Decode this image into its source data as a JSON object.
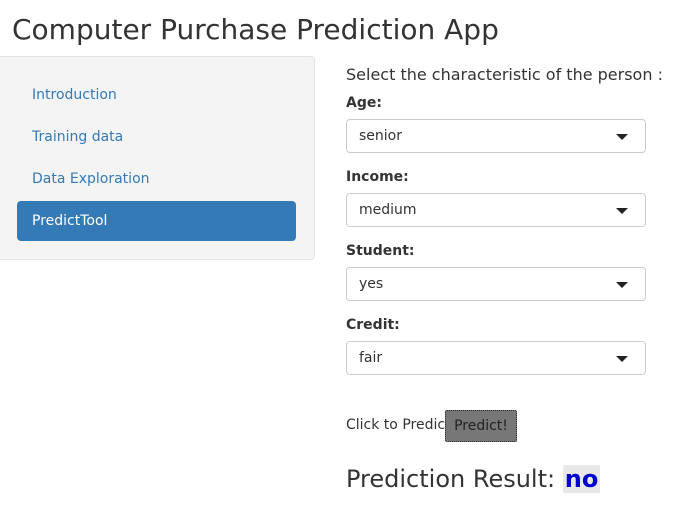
{
  "header": {
    "title": "Computer Purchase Prediction App"
  },
  "sidebar": {
    "items": [
      {
        "label": "Introduction",
        "active": false
      },
      {
        "label": "Training data",
        "active": false
      },
      {
        "label": "Data Exploration",
        "active": false
      },
      {
        "label": "PredictTool",
        "active": true
      }
    ]
  },
  "main": {
    "prompt": "Select the characteristic of the person :",
    "fields": {
      "age": {
        "label": "Age:",
        "value": "senior"
      },
      "income": {
        "label": "Income:",
        "value": "medium"
      },
      "student": {
        "label": "Student:",
        "value": "yes"
      },
      "credit": {
        "label": "Credit:",
        "value": "fair"
      }
    },
    "predict_label": "Click to Predict:",
    "predict_button": "Predict!",
    "result_label": "Prediction Result:",
    "result_value": "no"
  },
  "colors": {
    "accent": "#337ab7",
    "result_text": "#0000cc",
    "button_bg": "#777777"
  }
}
